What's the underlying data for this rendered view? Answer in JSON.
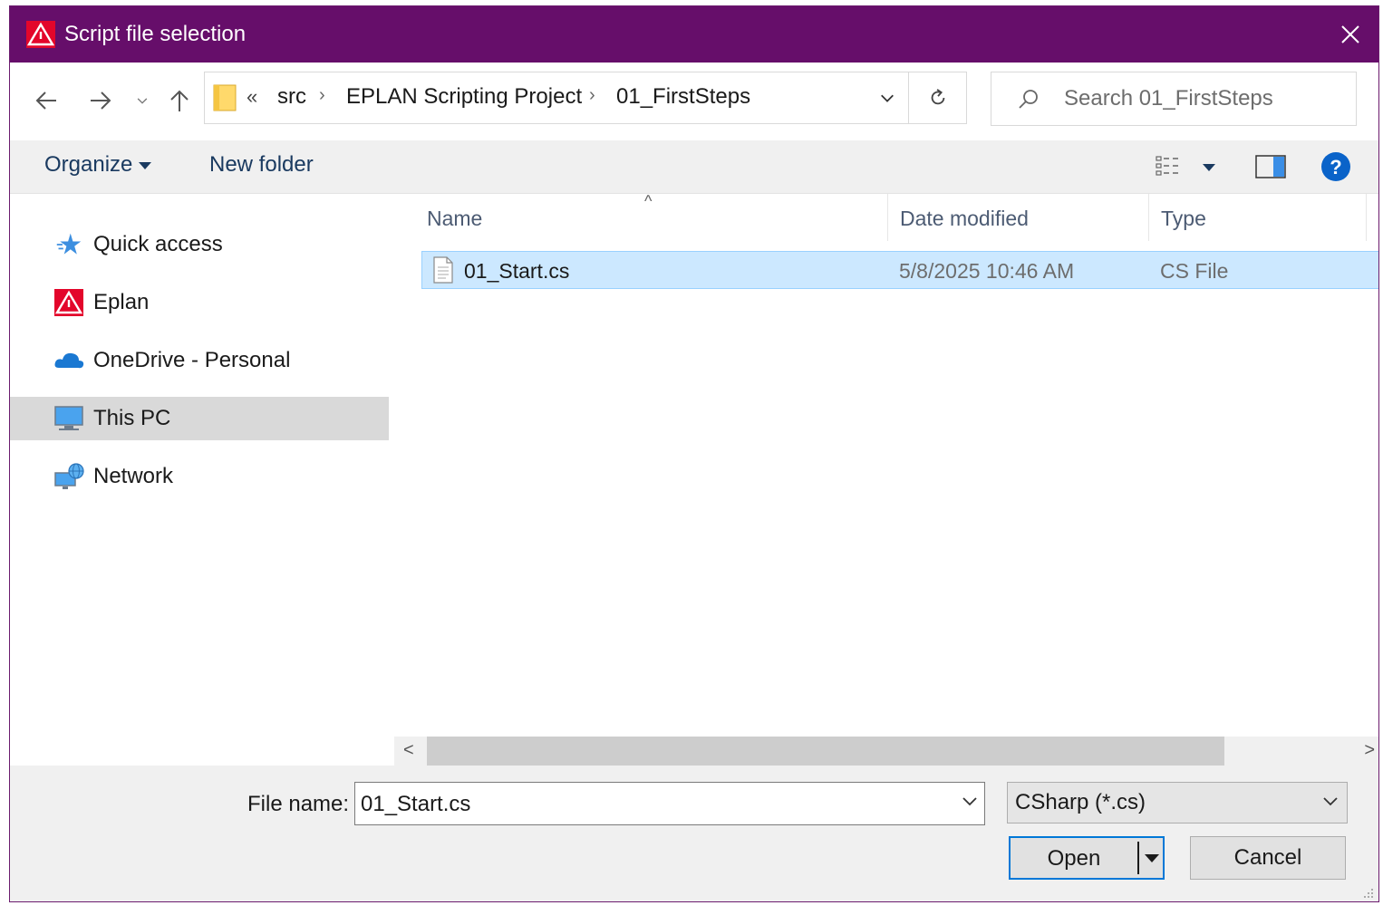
{
  "window": {
    "title": "Script file selection",
    "accent_color": "#660e6a",
    "app_icon": "eplan-logo-icon",
    "close_icon": "close-icon"
  },
  "navigation": {
    "back_icon": "arrow-left-icon",
    "forward_icon": "arrow-right-icon",
    "recent_icon": "chevron-down-icon",
    "up_icon": "arrow-up-icon",
    "overflow": "«",
    "breadcrumb": [
      "src",
      "EPLAN Scripting Project",
      "01_FirstSteps"
    ],
    "refresh_icon": "refresh-icon",
    "search_placeholder": "Search 01_FirstSteps"
  },
  "toolbar": {
    "organize_label": "Organize",
    "new_folder_label": "New folder",
    "view_icon": "details-view-icon",
    "preview_pane_icon": "preview-pane-icon",
    "help_label": "?"
  },
  "sidebar": {
    "items": [
      {
        "label": "Quick access",
        "icon": "star-icon",
        "selected": false
      },
      {
        "label": "Eplan",
        "icon": "eplan-logo-icon",
        "selected": false
      },
      {
        "label": "OneDrive - Personal",
        "icon": "cloud-icon",
        "selected": false
      },
      {
        "label": "This PC",
        "icon": "computer-icon",
        "selected": true
      },
      {
        "label": "Network",
        "icon": "network-icon",
        "selected": false
      }
    ]
  },
  "file_list": {
    "columns": [
      "Name",
      "Date modified",
      "Type"
    ],
    "rows": [
      {
        "name": "01_Start.cs",
        "date_modified": "5/8/2025 10:46 AM",
        "type": "CS File",
        "selected": true
      }
    ]
  },
  "footer": {
    "file_name_label": "File name:",
    "file_name_value": "01_Start.cs",
    "filter_value": "CSharp (*.cs)",
    "open_label": "Open",
    "cancel_label": "Cancel"
  }
}
